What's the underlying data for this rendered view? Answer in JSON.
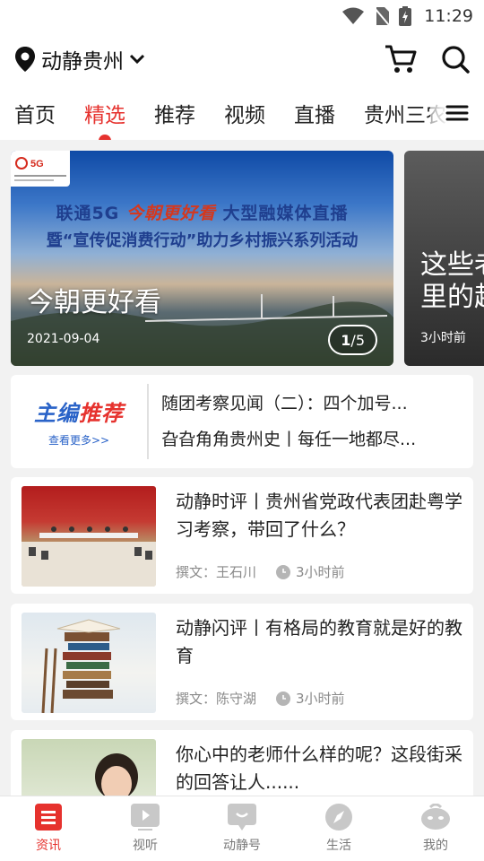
{
  "status_bar": {
    "time": "11:29"
  },
  "header": {
    "location": "动静贵州"
  },
  "tabs": [
    {
      "label": "首页",
      "active": false
    },
    {
      "label": "精选",
      "active": true
    },
    {
      "label": "推荐",
      "active": false
    },
    {
      "label": "视频",
      "active": false
    },
    {
      "label": "直播",
      "active": false
    },
    {
      "label": "贵州三农",
      "active": false
    }
  ],
  "banner": {
    "line1_pre": "联通5G",
    "line1_highlight": "今朝更好看",
    "line1_post": "大型融媒体直播",
    "line2": "暨“宣传促消费行动”助力乡村振兴系列活动",
    "title": "今朝更好看",
    "date": "2021-09-04",
    "page_current": "1",
    "page_total": "/5",
    "next_title": "这些老\n里的超",
    "next_time": "3小时前"
  },
  "editor_pick": {
    "logo_part1": "主编",
    "logo_part2": "推荐",
    "more": "查看更多>>",
    "items": [
      "随团考察见闻（二）：四个加号...",
      "旮旮角角贵州史丨每任一地都尽..."
    ]
  },
  "articles": [
    {
      "title": "动静时评丨贵州省党政代表团赴粤学习考察，带回了什么？",
      "author": "撰文：王石川",
      "time": "3小时前"
    },
    {
      "title": "动静闪评丨有格局的教育就是好的教育",
      "author": "撰文：陈守湖",
      "time": "3小时前"
    },
    {
      "title": "你心中的老师什么样的呢？这段街采的回答让人......",
      "author": "",
      "time": ""
    }
  ],
  "bottom_nav": [
    {
      "label": "资讯",
      "active": true
    },
    {
      "label": "视听",
      "active": false
    },
    {
      "label": "动静号",
      "active": false
    },
    {
      "label": "生活",
      "active": false
    },
    {
      "label": "我的",
      "active": false
    }
  ],
  "colors": {
    "accent": "#e6322e",
    "link_blue": "#2a63c8"
  }
}
